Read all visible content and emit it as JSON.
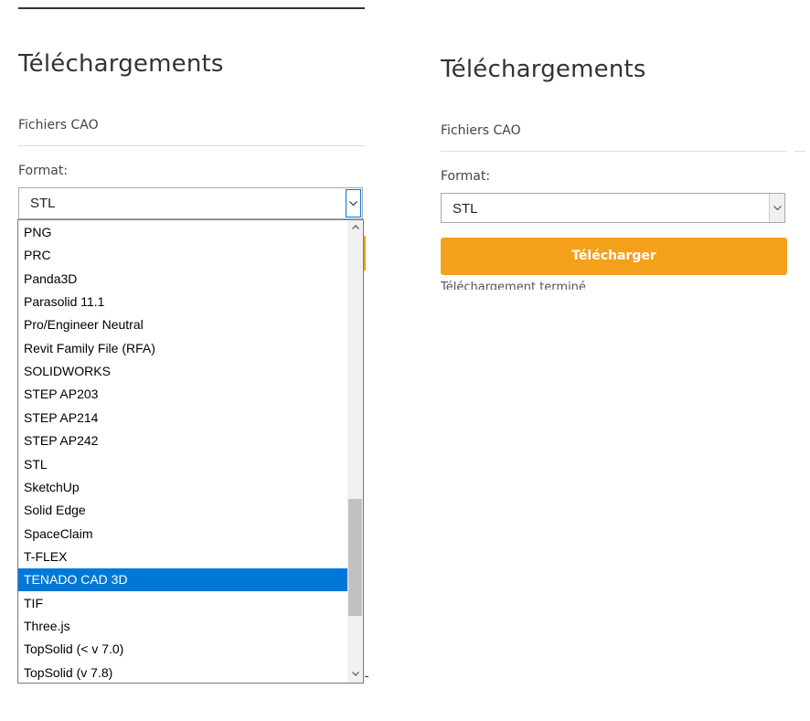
{
  "left_panel": {
    "heading": "Téléchargements",
    "section_label": "Fichiers CAO",
    "format_label": "Format:",
    "selected_format": "STL"
  },
  "right_panel": {
    "heading": "Téléchargements",
    "section_label": "Fichiers CAO",
    "format_label": "Format:",
    "selected_format": "STL",
    "download_button": "Télécharger",
    "status_text": "Téléchargement terminé"
  },
  "dropdown": {
    "options": [
      "PNG",
      "PRC",
      "Panda3D",
      "Parasolid 11.1",
      "Pro/Engineer Neutral",
      "Revit Family File (RFA)",
      "SOLIDWORKS",
      "STEP AP203",
      "STEP AP214",
      "STEP AP242",
      "STL",
      "SketchUp",
      "Solid Edge",
      "SpaceClaim",
      "T-FLEX",
      "TENADO CAD 3D",
      "TIF",
      "Three.js",
      "TopSolid (< v 7.0)",
      "TopSolid (v 7.8)"
    ],
    "highlighted": "TENADO CAD 3D"
  },
  "icons": {
    "select_arrow": "chevron-down-icon",
    "scroll_up": "scroll-up-arrow-icon",
    "scroll_down": "scroll-down-arrow-icon"
  },
  "colors": {
    "accent": "#f5a01a",
    "selection": "#0078d7",
    "text": "#333333"
  }
}
